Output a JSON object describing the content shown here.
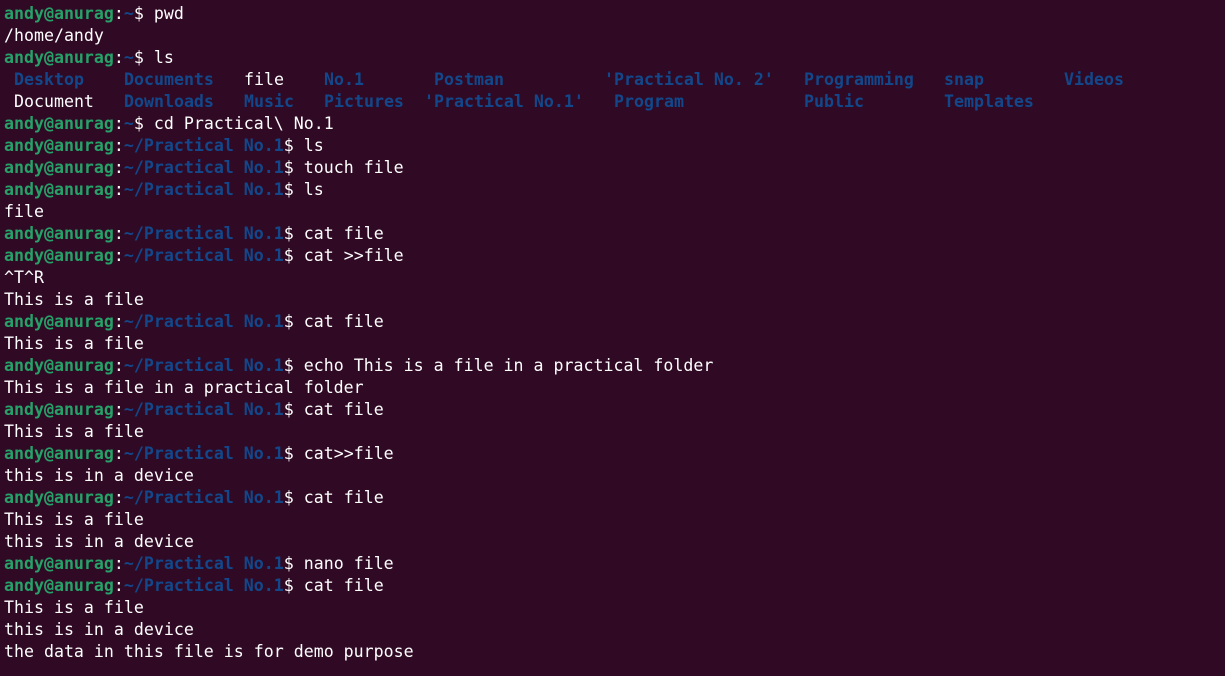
{
  "prompt": {
    "user_host": "andy@anurag",
    "home_path": "~",
    "practical_path": "~/Practical No.1",
    "symbol": "$"
  },
  "colors": {
    "background": "#300a24",
    "user_host": "#26a269",
    "path": "#12488b",
    "text": "#ffffff"
  },
  "lines": [
    {
      "type": "cmd",
      "path": "~",
      "cmd": " pwd"
    },
    {
      "type": "out",
      "text": "/home/andy"
    },
    {
      "type": "cmd",
      "path": "~",
      "cmd": " ls"
    },
    {
      "type": "ls",
      "row": 0
    },
    {
      "type": "ls",
      "row": 1
    },
    {
      "type": "cmd",
      "path": "~",
      "cmd": " cd Practical\\ No.1"
    },
    {
      "type": "cmd",
      "path": "~/Practical No.1",
      "cmd": " ls"
    },
    {
      "type": "cmd",
      "path": "~/Practical No.1",
      "cmd": " touch file"
    },
    {
      "type": "cmd",
      "path": "~/Practical No.1",
      "cmd": " ls"
    },
    {
      "type": "out",
      "text": "file"
    },
    {
      "type": "cmd",
      "path": "~/Practical No.1",
      "cmd": " cat file"
    },
    {
      "type": "cmd",
      "path": "~/Practical No.1",
      "cmd": " cat >>file"
    },
    {
      "type": "out",
      "text": "^T^R"
    },
    {
      "type": "out",
      "text": "This is a file"
    },
    {
      "type": "cmd",
      "path": "~/Practical No.1",
      "cmd": " cat file"
    },
    {
      "type": "out",
      "text": "This is a file"
    },
    {
      "type": "cmd",
      "path": "~/Practical No.1",
      "cmd": " echo This is a file in a practical folder"
    },
    {
      "type": "out",
      "text": "This is a file in a practical folder"
    },
    {
      "type": "cmd",
      "path": "~/Practical No.1",
      "cmd": " cat file"
    },
    {
      "type": "out",
      "text": "This is a file"
    },
    {
      "type": "cmd",
      "path": "~/Practical No.1",
      "cmd": " cat>>file"
    },
    {
      "type": "out",
      "text": "this is in a device"
    },
    {
      "type": "cmd",
      "path": "~/Practical No.1",
      "cmd": " cat file"
    },
    {
      "type": "out",
      "text": "This is a file"
    },
    {
      "type": "out",
      "text": "this is in a device"
    },
    {
      "type": "cmd",
      "path": "~/Practical No.1",
      "cmd": " nano file"
    },
    {
      "type": "cmd",
      "path": "~/Practical No.1",
      "cmd": " cat file"
    },
    {
      "type": "out",
      "text": "This is a file"
    },
    {
      "type": "out",
      "text": "this is in a device"
    },
    {
      "type": "out",
      "text": "the data in this file is for demo purpose"
    }
  ],
  "ls_listing": [
    [
      {
        "name": "Desktop",
        "kind": "dir"
      },
      {
        "name": "Documents",
        "kind": "dir"
      },
      {
        "name": "file",
        "kind": "file"
      },
      {
        "name": "No.1",
        "kind": "dir"
      },
      {
        "name": "Postman",
        "kind": "dir"
      },
      {
        "name": "'Practical No. 2'",
        "kind": "dir"
      },
      {
        "name": "Programming",
        "kind": "dir"
      },
      {
        "name": "snap",
        "kind": "dir"
      },
      {
        "name": "Videos",
        "kind": "dir"
      }
    ],
    [
      {
        "name": "Document",
        "kind": "file"
      },
      {
        "name": "Downloads",
        "kind": "dir"
      },
      {
        "name": "Music",
        "kind": "dir"
      },
      {
        "name": "Pictures",
        "kind": "dir"
      },
      {
        "name": "'Practical No.1'",
        "kind": "dir"
      },
      {
        "name": "Program",
        "kind": "dir"
      },
      {
        "name": "Public",
        "kind": "dir"
      },
      {
        "name": "Templates",
        "kind": "dir"
      }
    ]
  ]
}
